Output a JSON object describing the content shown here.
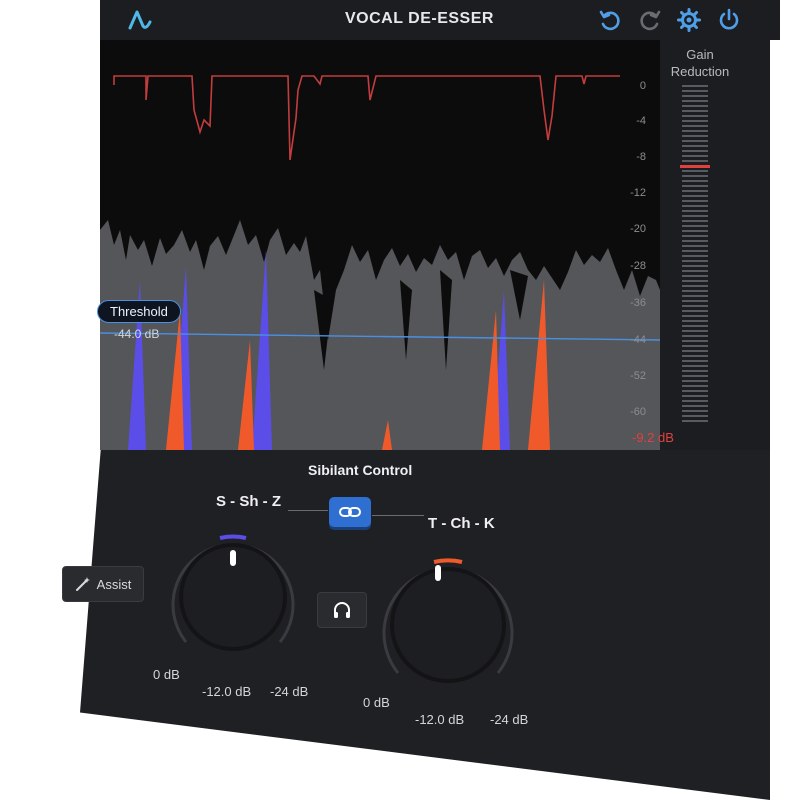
{
  "header": {
    "title": "VOCAL DE-ESSER",
    "icons": [
      "undo-icon",
      "redo-icon",
      "gear-icon",
      "power-icon"
    ],
    "accent": "#4fb8e8"
  },
  "meter": {
    "scale_ticks": [
      "0",
      "-4",
      "-8",
      "-12",
      "-20",
      "-28",
      "-36",
      "-44",
      "-52",
      "-60"
    ],
    "gain_reduction_label_1": "Gain",
    "gain_reduction_label_2": "Reduction",
    "gain_reduction_value": "-9.2 dB",
    "reduction_color": "#e0413e"
  },
  "threshold": {
    "label": "Threshold",
    "value": "-44.0 dB",
    "line_color": "#4a90e2"
  },
  "sibilant": {
    "title": "Sibilant Control",
    "left_band": {
      "name": "S - Sh - Z",
      "min_label": "0 dB",
      "mid_label": "-12.0 dB",
      "max_label": "-24 dB",
      "accent": "#5b4de8"
    },
    "right_band": {
      "name": "T - Ch - K",
      "min_label": "0 dB",
      "mid_label": "-12.0 dB",
      "max_label": "-24 dB",
      "accent": "#f05a2a"
    },
    "link_icon": "link-icon",
    "listen_icon": "headphones-icon"
  },
  "assist": {
    "label": "Assist",
    "icon": "magic-wand-icon"
  }
}
